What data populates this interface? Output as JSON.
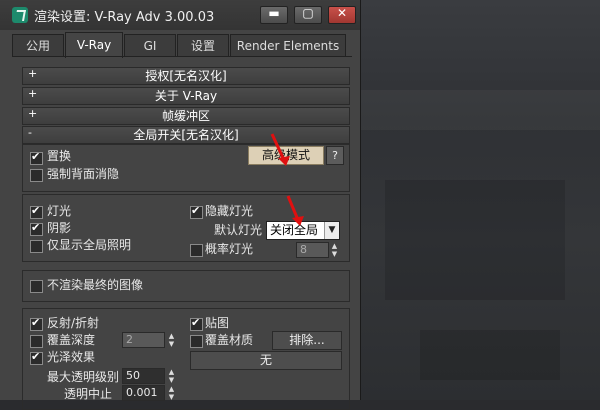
{
  "window": {
    "title": "渲染设置: V-Ray Adv 3.00.03"
  },
  "titlebar_buttons": {
    "minimize": "▬",
    "maximize": "▢",
    "close": "✕"
  },
  "tabs": [
    {
      "label": "公用"
    },
    {
      "label": "V-Ray"
    },
    {
      "label": "GI"
    },
    {
      "label": "设置"
    },
    {
      "label": "Render Elements"
    }
  ],
  "rollouts": [
    {
      "sign": "+",
      "label": "授权[无名汉化]"
    },
    {
      "sign": "+",
      "label": "关于 V-Ray"
    },
    {
      "sign": "+",
      "label": "帧缓冲区"
    },
    {
      "sign": "-",
      "label": "全局开关[无名汉化]"
    }
  ],
  "global": {
    "displacement": {
      "label": "置换",
      "checked": true
    },
    "force_backface": {
      "label": "强制背面消隐",
      "checked": false
    },
    "advanced_mode_button": "高级模式",
    "help_button": "?"
  },
  "lights": {
    "lights": {
      "label": "灯光",
      "checked": true
    },
    "shadows": {
      "label": "阴影",
      "checked": true
    },
    "show_gi_only": {
      "label": "仅显示全局照明",
      "checked": false
    },
    "hidden_lights": {
      "label": "隐藏灯光",
      "checked": true
    },
    "default_lights_label": "默认灯光",
    "default_lights_value": "关闭全局",
    "probabilistic_lights": {
      "label": "概率灯光",
      "checked": false
    },
    "probabilistic_value": "8"
  },
  "final": {
    "dont_render_final": {
      "label": "不渲染最终的图像",
      "checked": false
    }
  },
  "materials": {
    "reflection_refraction": {
      "label": "反射/折射",
      "checked": true
    },
    "override_depth": {
      "label": "覆盖深度",
      "checked": false
    },
    "override_depth_value": "2",
    "glossy_effects": {
      "label": "光泽效果",
      "checked": true
    },
    "max_transp_levels_label": "最大透明级别",
    "max_transp_levels_value": "50",
    "transp_cutoff_label": "透明中止",
    "transp_cutoff_value": "0.001",
    "maps": {
      "label": "贴图",
      "checked": true
    },
    "override_mtl": {
      "label": "覆盖材质",
      "checked": false
    },
    "exclude_button": "排除...",
    "none_button": "无"
  }
}
